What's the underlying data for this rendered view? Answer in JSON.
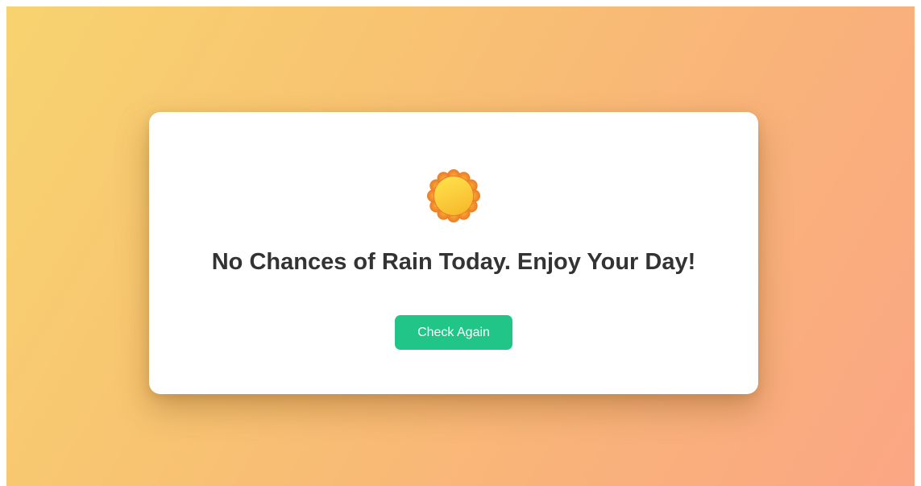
{
  "message": {
    "text": "No Chances of Rain Today. Enjoy Your Day!",
    "icon": "sun-icon"
  },
  "actions": {
    "check_again_label": "Check Again"
  },
  "colors": {
    "background_start": "#f7d36f",
    "background_end": "#fba684",
    "card": "#ffffff",
    "text": "#333333",
    "button": "#20c587",
    "button_text": "#ffffff",
    "sun_core": "#fdd835",
    "sun_petals": "#f08a24"
  }
}
